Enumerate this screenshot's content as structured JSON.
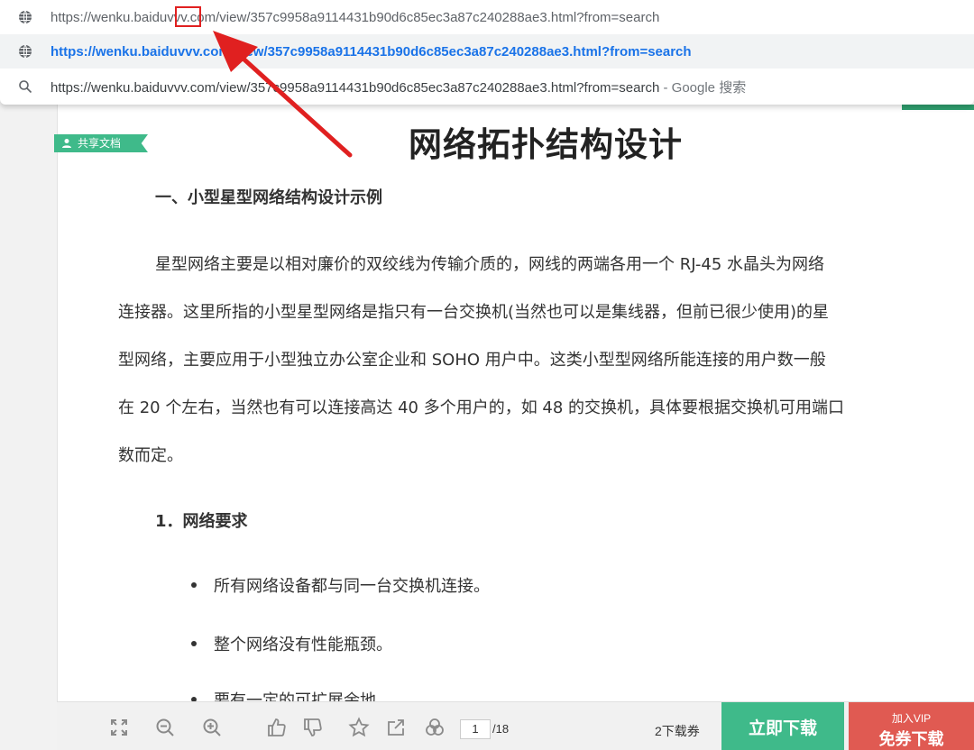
{
  "browser": {
    "suggestions": [
      {
        "url": "https://wenku.baiduvvv.com/view/357c9958a9114431b90d6c85ec3a87c240288ae3.html?from=search",
        "icon": "globe-icon"
      },
      {
        "url": "https://wenku.baiduvvv.com/view/357c9958a9114431b90d6c85ec3a87c240288ae3.html?from=search",
        "icon": "globe-icon"
      },
      {
        "url": "https://wenku.baiduvvv.com/view/357c9958a9114431b90d6c85ec3a87c240288ae3.html?from=search",
        "suffix": " - Google 搜索",
        "icon": "search-icon"
      }
    ]
  },
  "document": {
    "tag": "共享文档",
    "title": "网络拓扑结构设计",
    "section_heading": "一、小型星型网络结构设计示例",
    "paragraph_lines": [
      "星型网络主要是以相对廉价的双绞线为传输介质的，网线的两端各用一个 RJ-45 水晶头为网络",
      "连接器。这里所指的小型星型网络是指只有一台交换机(当然也可以是集线器，但前已很少使用)的星",
      "型网络，主要应用于小型独立办公室企业和 SOHO 用户中。这类小型型网络所能连接的用户数一般",
      "在 20 个左右，当然也有可以连接高达 40 多个用户的，如 48 的交换机，具体要根据交换机可用端口",
      "数而定。"
    ],
    "sub_heading": "1．网络要求",
    "bullets": [
      "所有网络设备都与同一台交换机连接。",
      "整个网络没有性能瓶颈。",
      "要有一定的可扩展余地。"
    ]
  },
  "toolbar": {
    "current_page": "1",
    "total_pages": "/18",
    "coupon_text": "2下载券",
    "download_label": "立即下载",
    "vip_small": "加入VIP",
    "vip_big": "免券下载"
  },
  "colors": {
    "accent_green": "#3fba8a",
    "vip_red": "#e05a52",
    "annotation_red": "#e02020",
    "link_blue": "#1a73e8"
  }
}
